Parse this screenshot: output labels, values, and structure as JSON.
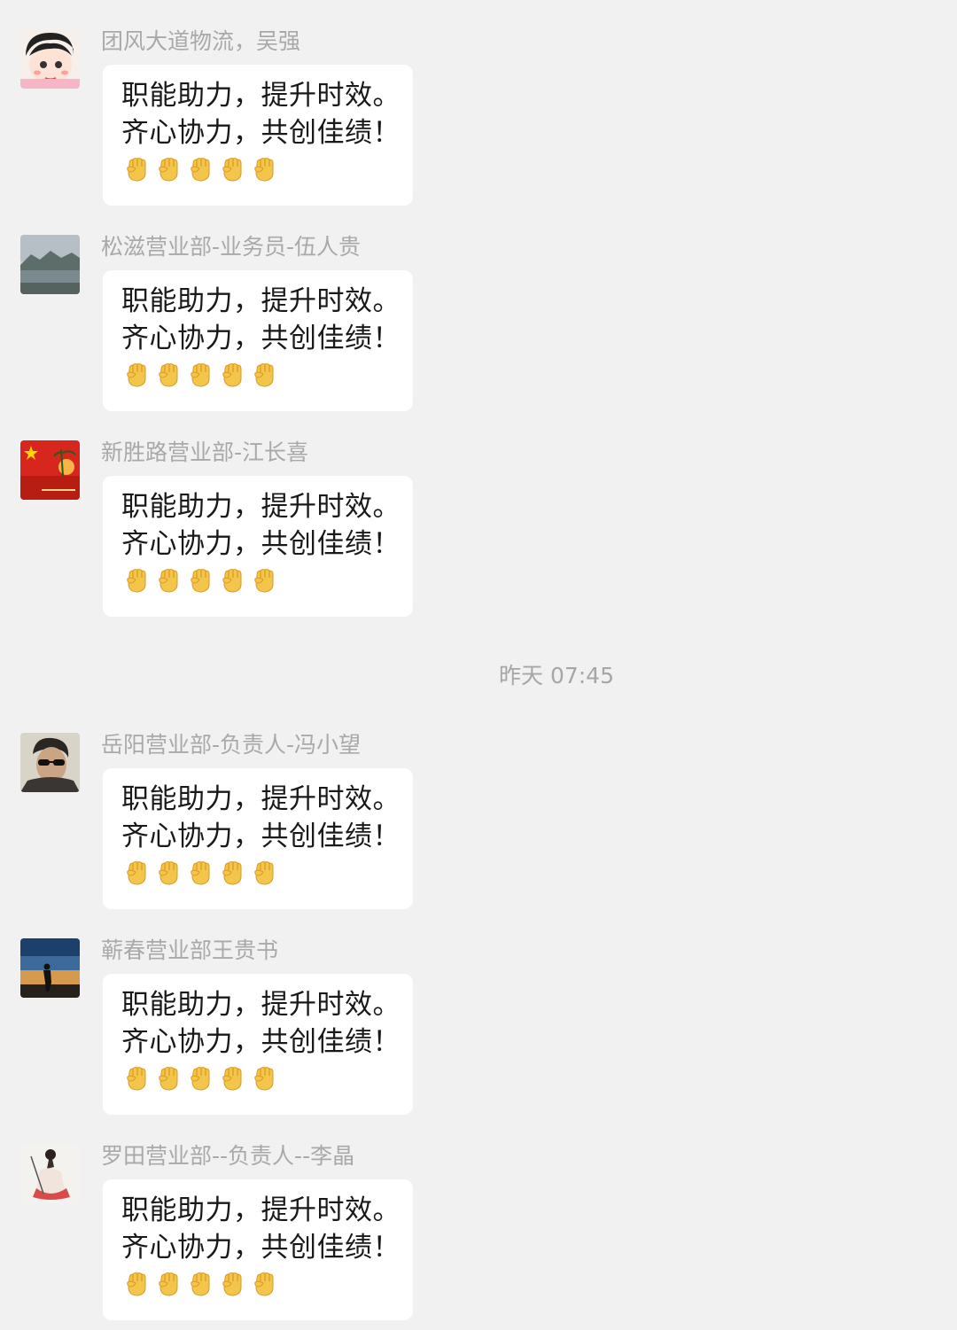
{
  "messages": [
    {
      "sender": "团风大道物流，吴强",
      "line1": "职能助力，提升时效。",
      "line2": "齐心协力，共创佳绩！",
      "avatar_icon": "cartoon-girl-avatar",
      "emoji": "raised-fist-emoji",
      "emoji_count": 5
    },
    {
      "sender": "松滋营业部-业务员-伍人贵",
      "line1": "职能助力，提升时效。",
      "line2": "齐心协力，共创佳绩！",
      "avatar_icon": "lake-landscape-avatar",
      "emoji": "raised-fist-emoji",
      "emoji_count": 5
    },
    {
      "sender": "新胜路营业部-江长喜",
      "line1": "职能助力，提升时效。",
      "line2": "齐心协力，共创佳绩！",
      "avatar_icon": "flag-sunset-avatar",
      "emoji": "raised-fist-emoji",
      "emoji_count": 5
    },
    {
      "sender": "岳阳营业部-负责人-冯小望",
      "line1": "职能助力，提升时效。",
      "line2": "齐心协力，共创佳绩！",
      "avatar_icon": "man-sunglasses-avatar",
      "emoji": "raised-fist-emoji",
      "emoji_count": 5
    },
    {
      "sender": "蕲春营业部王贵书",
      "line1": "职能助力，提升时效。",
      "line2": "齐心协力，共创佳绩！",
      "avatar_icon": "silhouette-sky-avatar",
      "emoji": "raised-fist-emoji",
      "emoji_count": 5
    },
    {
      "sender": "罗田营业部--负责人--李晶",
      "line1": "职能助力，提升时效。",
      "line2": "齐心协力，共创佳绩！",
      "avatar_icon": "ink-painting-avatar",
      "emoji": "raised-fist-emoji",
      "emoji_count": 5
    }
  ],
  "timestamp": "昨天 07:45",
  "colors": {
    "background": "#f1f1f1",
    "bubble": "#ffffff",
    "sender_text": "#a9a9a9",
    "message_text": "#191919",
    "timestamp_text": "#a6a6a6"
  }
}
